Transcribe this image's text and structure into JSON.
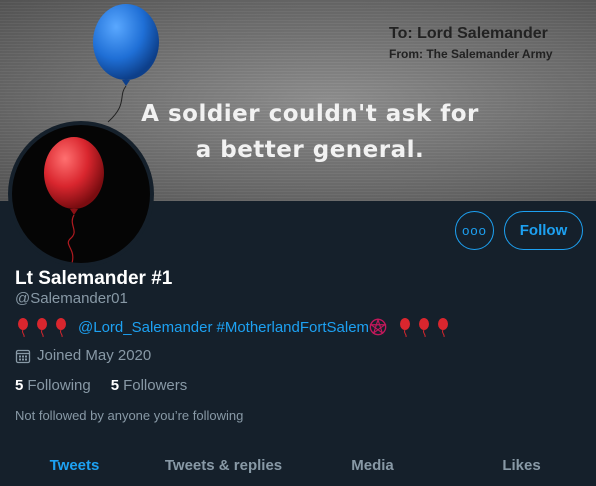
{
  "banner": {
    "to_line": "To: Lord Salemander",
    "from_line": "From: The Salemander Army",
    "slogan_line1": "A soldier couldn't ask for",
    "slogan_line2": "a better general."
  },
  "profile": {
    "display_name": "Lt Salemander #1",
    "handle": "@Salemander01",
    "bio": {
      "mention": "@Lord_Salemander",
      "hashtag": "#MotherlandFortSalem",
      "emoji_leading": [
        "red-balloon",
        "red-balloon",
        "red-balloon"
      ],
      "emoji_trailing": [
        "red-balloon",
        "red-balloon",
        "red-balloon"
      ],
      "symbol": "pentagram"
    },
    "joined": "Joined May 2020",
    "following_count": "5",
    "following_label": "Following",
    "followers_count": "5",
    "followers_label": "Followers",
    "not_followed": "Not followed by anyone you’re following"
  },
  "actions": {
    "more_label": "ooo",
    "follow_label": "Follow"
  },
  "tabs": [
    {
      "label": "Tweets",
      "active": true
    },
    {
      "label": "Tweets & replies",
      "active": false
    },
    {
      "label": "Media",
      "active": false
    },
    {
      "label": "Likes",
      "active": false
    }
  ],
  "colors": {
    "background": "#15202b",
    "accent": "#1da1f2",
    "secondary_text": "#8899a6",
    "balloon_red": "#d9262e",
    "balloon_blue": "#1f6fd6"
  }
}
